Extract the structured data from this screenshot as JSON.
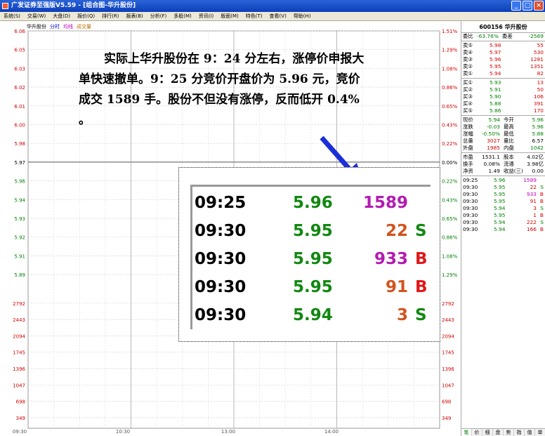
{
  "window": {
    "title": "广发证券至强版V5.59 - [组合图-华升股份]",
    "buttons": [
      "_",
      "□",
      "×"
    ]
  },
  "menu": [
    "系统(S)",
    "交易(W)",
    "大盘(D)",
    "报价(Q)",
    "排行(R)",
    "报表(B)",
    "分析(F)",
    "多股(M)",
    "资讯(I)",
    "版面(M)",
    "特色(T)",
    "查看(V)",
    "帮助(H)"
  ],
  "chart": {
    "legend": {
      "name": "华升股份",
      "fenshi": "分时",
      "junxian": "均线",
      "volume": "成交量"
    },
    "price_left": [
      "6.06",
      "6.05",
      "6.03",
      "6.02",
      "6.01",
      "6.00",
      "5.98",
      "5.97",
      "5.96",
      "5.94",
      "5.93",
      "5.92",
      "5.91",
      "5.89"
    ],
    "pct_right": [
      "1.51%",
      "1.29%",
      "1.08%",
      "0.86%",
      "0.65%",
      "0.43%",
      "0.22%",
      "0.00%",
      "0.22%",
      "0.43%",
      "0.65%",
      "0.86%",
      "1.08%",
      "1.29%"
    ],
    "vol_labels": [
      "2792",
      "2443",
      "2094",
      "1745",
      "1396",
      "1047",
      "698",
      "349"
    ],
    "time_labels": [
      "09:30",
      "10:30",
      "13:00",
      "14:00"
    ],
    "colors": {
      "up": "#d40000",
      "down": "#008000",
      "mid": "#000000",
      "grid": "#c8c8c8"
    }
  },
  "annotation": "实际上华升股份在 9：24 分左右，涨停价申报大单快速撤单。9：25 分竞价开盘价为 5.96 元，竞价成交 1589 手。股份不但没有涨停，反而低开 0.4% 。",
  "inset_trades": [
    {
      "time": "09:25",
      "price": "5.96",
      "vol": "1589",
      "flag": "",
      "color": "#b31bb3"
    },
    {
      "time": "09:30",
      "price": "5.95",
      "vol": "22",
      "flag": "S",
      "color": "#d2541e"
    },
    {
      "time": "09:30",
      "price": "5.95",
      "vol": "933",
      "flag": "B",
      "color": "#b31bb3"
    },
    {
      "time": "09:30",
      "price": "5.95",
      "vol": "91",
      "flag": "B",
      "color": "#d2541e"
    },
    {
      "time": "09:30",
      "price": "5.94",
      "vol": "3",
      "flag": "S",
      "color": "#d2541e"
    }
  ],
  "panel": {
    "header": "600156 华升股份",
    "weibi": {
      "label": "委比",
      "value": "-63.76%",
      "label2": "委差",
      "value2": "-2569"
    },
    "sell": [
      {
        "label": "卖⑤",
        "price": "5.98",
        "vol": "55"
      },
      {
        "label": "卖④",
        "price": "5.97",
        "vol": "530"
      },
      {
        "label": "卖③",
        "price": "5.96",
        "vol": "1281"
      },
      {
        "label": "卖②",
        "price": "5.95",
        "vol": "1351"
      },
      {
        "label": "卖①",
        "price": "5.94",
        "vol": "82"
      }
    ],
    "buy": [
      {
        "label": "买①",
        "price": "5.93",
        "vol": "13"
      },
      {
        "label": "买②",
        "price": "5.91",
        "vol": "50"
      },
      {
        "label": "买③",
        "price": "5.90",
        "vol": "106"
      },
      {
        "label": "买④",
        "price": "5.88",
        "vol": "391"
      },
      {
        "label": "买⑤",
        "price": "5.86",
        "vol": "170"
      }
    ],
    "stats": [
      {
        "l1": "现价",
        "v1": "5.94",
        "l2": "今开",
        "v2": "5.96"
      },
      {
        "l1": "涨跌",
        "v1": "-0.03",
        "l2": "最高",
        "v2": "5.96"
      },
      {
        "l1": "涨幅",
        "v1": "-0.50%",
        "l2": "最低",
        "v2": "5.88"
      },
      {
        "l1": "总量",
        "v1": "3027",
        "l2": "量比",
        "v2": "6.57"
      },
      {
        "l1": "外盘",
        "v1": "1985",
        "l2": "内盘",
        "v2": "1042"
      }
    ],
    "stats2": [
      {
        "l1": "市盈",
        "v1": "1531.1",
        "l2": "股本",
        "v2": "4.02亿"
      },
      {
        "l1": "换手",
        "v1": "0.08%",
        "l2": "流通",
        "v2": "3.98亿"
      },
      {
        "l1": "净资",
        "v1": "1.49",
        "l2": "收益(三)",
        "v2": "0.00"
      }
    ],
    "ticks": [
      {
        "time": "09:25",
        "price": "5.96",
        "vol": "1589",
        "flag": ""
      },
      {
        "time": "09:30",
        "price": "5.95",
        "vol": "22",
        "flag": "S"
      },
      {
        "time": "09:30",
        "price": "5.95",
        "vol": "933",
        "flag": "B"
      },
      {
        "time": "09:30",
        "price": "5.95",
        "vol": "91",
        "flag": "B"
      },
      {
        "time": "09:30",
        "price": "5.94",
        "vol": "3",
        "flag": "S"
      },
      {
        "time": "09:30",
        "price": "5.95",
        "vol": "1",
        "flag": "B"
      },
      {
        "time": "09:30",
        "price": "5.94",
        "vol": "222",
        "flag": "S"
      },
      {
        "time": "09:30",
        "price": "5.94",
        "vol": "166",
        "flag": "B"
      }
    ],
    "tabs": [
      "笔",
      "价",
      "细",
      "盘",
      "势",
      "指",
      "值",
      "单"
    ]
  }
}
